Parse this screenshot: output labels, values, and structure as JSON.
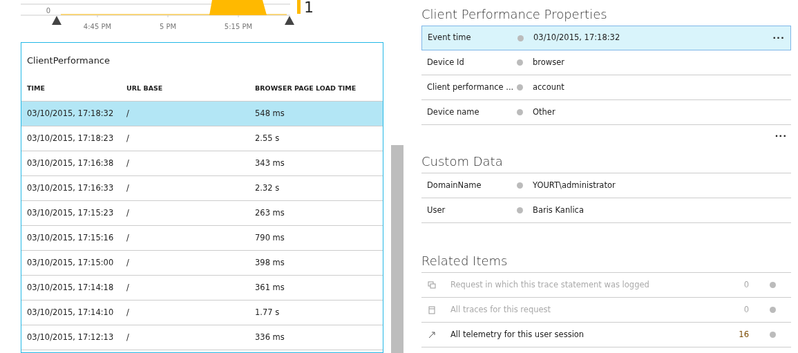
{
  "timeline": {
    "y_tick": "0",
    "x_labels": [
      "4:45 PM",
      "5 PM",
      "5:15 PM"
    ],
    "count": "1"
  },
  "table": {
    "title": "ClientPerformance",
    "columns": [
      "TIME",
      "URL BASE",
      "BROWSER PAGE LOAD TIME"
    ],
    "rows": [
      {
        "cells": [
          "03/10/2015, 17:18:32",
          "/",
          "548 ms"
        ],
        "selected": true
      },
      {
        "cells": [
          "03/10/2015, 17:18:23",
          "/",
          "2.55 s"
        ],
        "selected": false
      },
      {
        "cells": [
          "03/10/2015, 17:16:38",
          "/",
          "343 ms"
        ],
        "selected": false
      },
      {
        "cells": [
          "03/10/2015, 17:16:33",
          "/",
          "2.32 s"
        ],
        "selected": false
      },
      {
        "cells": [
          "03/10/2015, 17:15:23",
          "/",
          "263 ms"
        ],
        "selected": false
      },
      {
        "cells": [
          "03/10/2015, 17:15:16",
          "/",
          "790 ms"
        ],
        "selected": false
      },
      {
        "cells": [
          "03/10/2015, 17:15:00",
          "/",
          "398 ms"
        ],
        "selected": false
      },
      {
        "cells": [
          "03/10/2015, 17:14:18",
          "/",
          "361 ms"
        ],
        "selected": false
      },
      {
        "cells": [
          "03/10/2015, 17:14:10",
          "/",
          "1.77 s"
        ],
        "selected": false
      },
      {
        "cells": [
          "03/10/2015, 17:12:13",
          "/",
          "336 ms"
        ],
        "selected": false
      }
    ]
  },
  "properties": {
    "title": "Client Performance Properties",
    "more": "···",
    "rows": [
      {
        "label": "Event time",
        "value": "03/10/2015, 17:18:32",
        "selected": true,
        "more": "···"
      },
      {
        "label": "Device Id",
        "value": "browser",
        "selected": false
      },
      {
        "label": "Client performance ...",
        "value": "account",
        "selected": false
      },
      {
        "label": "Device name",
        "value": "Other",
        "selected": false
      }
    ]
  },
  "custom_data": {
    "title": "Custom Data",
    "rows": [
      {
        "label": "DomainName",
        "value": "YOURT\\administrator"
      },
      {
        "label": "User",
        "value": "Baris Kanlica"
      }
    ]
  },
  "related_items": {
    "title": "Related Items",
    "items": [
      {
        "kind": "request",
        "label": "Request in which this trace statement was logged",
        "count": "0",
        "disabled": true
      },
      {
        "kind": "traces",
        "label": "All traces for this request",
        "count": "0",
        "disabled": true
      },
      {
        "kind": "session",
        "label": "All telemetry for this user session",
        "count": "16",
        "disabled": false
      }
    ]
  }
}
